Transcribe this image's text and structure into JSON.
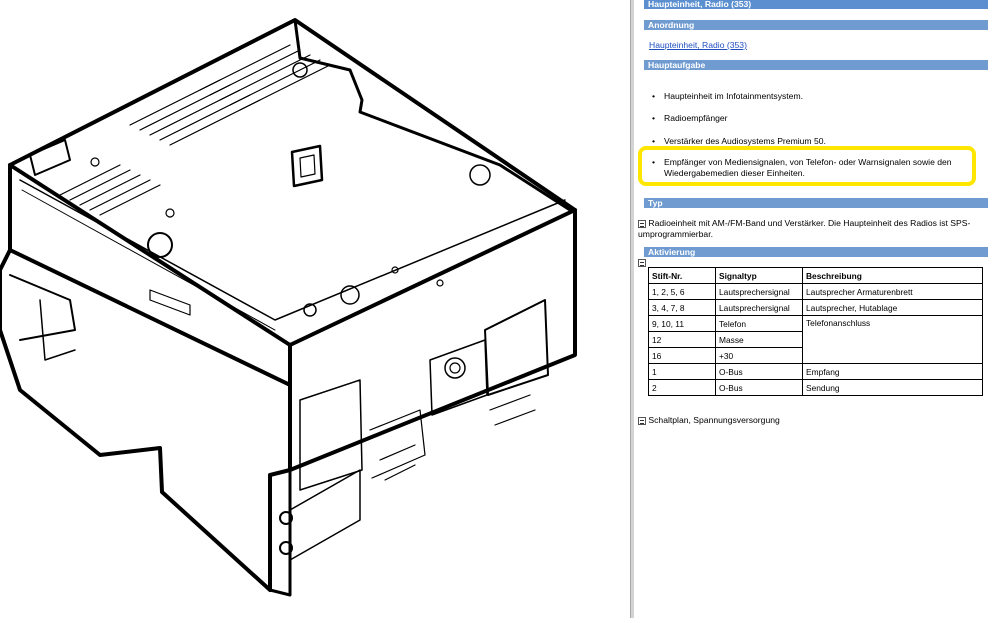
{
  "panel": {
    "title": "Haupteinheit, Radio (353)",
    "sections": {
      "anordnung": "Anordnung",
      "hauptaufgabe": "Hauptaufgabe",
      "typ": "Typ",
      "aktivierung": "Aktivierung"
    },
    "anordnung_link": "Haupteinheit, Radio (353)",
    "bullets": [
      "Haupteinheit im Infotainmentsystem.",
      "Radioempfänger",
      "Verstärker des Audiosystems Premium 50.",
      "Empfänger von Mediensignalen, von Telefon- oder Warnsignalen sowie den Wiedergabemedien dieser Einheiten."
    ],
    "bullet_symbol": "•",
    "typ_text": "Radioeinheit mit AM-/FM-Band und Verstärker. Die Haupteinheit des Radios ist SPS-umprogrammierbar.",
    "footer_text": "Schaltplan, Spannungsversorgung",
    "highlight_color": "#ffe600",
    "header_color": "#6f9bd0",
    "link_color": "#1f4fbf"
  },
  "table": {
    "headers": [
      "Stift-Nr.",
      "Signaltyp",
      "Beschreibung"
    ],
    "rows": [
      [
        "1, 2, 5, 6",
        "Lautsprechersignal",
        "Lautsprecher Armaturenbrett"
      ],
      [
        "3, 4, 7, 8",
        "Lautsprechersignal",
        "Lautsprecher, Hutablage"
      ],
      [
        "9, 10, 11",
        "Telefon",
        "Telefonanschluss"
      ],
      [
        "12",
        "Masse",
        ""
      ],
      [
        "16",
        "+30",
        ""
      ],
      [
        "1",
        "O-Bus",
        "Empfang"
      ],
      [
        "2",
        "O-Bus",
        "Sendung"
      ]
    ]
  },
  "icons": [
    "document-link-icon"
  ]
}
